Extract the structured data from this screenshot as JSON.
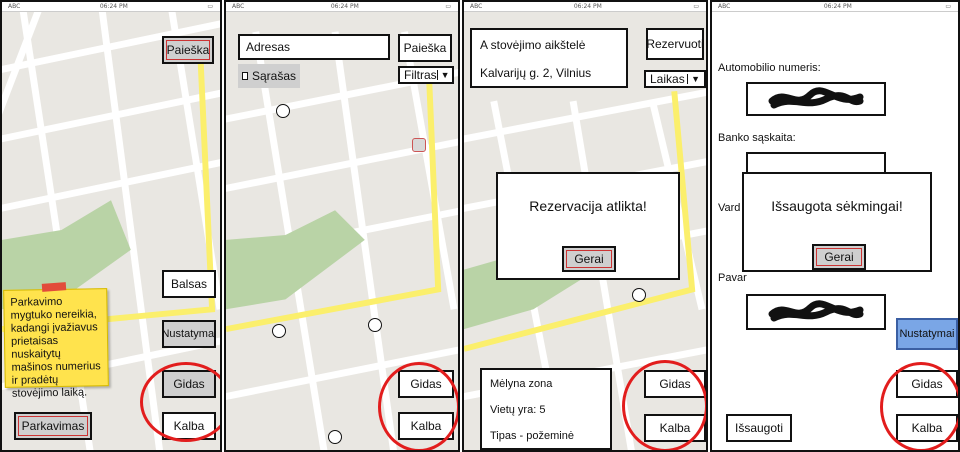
{
  "status_bar": {
    "carrier": "ABC",
    "time": "06:24 PM"
  },
  "screen1": {
    "search_button": "Paieška",
    "voice_button": "Balsas",
    "settings_button": "Nustatymai",
    "guide_button": "Gidas",
    "language_button": "Kalba",
    "parking_button": "Parkavimas",
    "sticky_note": "Parkavimo mygtuko nereikia, kadangi įvažiavus prietaisas nuskaitytų mašinos numerius ir pradėtų stovėjimo laiką."
  },
  "screen2": {
    "address_input": "Adresas",
    "search_button": "Paieška",
    "list_checkbox": "Sąrašas",
    "filter_select": "Filtras",
    "guide_button": "Gidas",
    "language_button": "Kalba"
  },
  "screen3": {
    "lot_name": "A stovėjimo aikštelė",
    "lot_address": "Kalvarijų g. 2, Vilnius",
    "reserve_button": "Rezervuoti",
    "time_select": "Laikas",
    "dialog_message": "Rezervacija atlikta!",
    "dialog_ok": "Gerai",
    "zone": "Mėlyna zona",
    "spots": "Vietų yra: 5",
    "type": "Tipas - požeminė",
    "guide_button": "Gidas",
    "language_button": "Kalba"
  },
  "screen4": {
    "car_number_label": "Automobilio numeris:",
    "bank_account_label": "Banko sąskaita:",
    "name_label": "Vard",
    "surname_label": "Pavar",
    "dialog_message": "Išsaugota sėkmingai!",
    "dialog_ok": "Gerai",
    "settings_button": "Nustatymai",
    "save_button": "Išsaugoti",
    "guide_button": "Gidas",
    "language_button": "Kalba"
  },
  "colors": {
    "highlight_circle": "#e21d1d",
    "route": "#fbef6c",
    "park": "#b9d3a6",
    "sticky": "#ffe34d",
    "blue_button": "#7aa6e6"
  }
}
